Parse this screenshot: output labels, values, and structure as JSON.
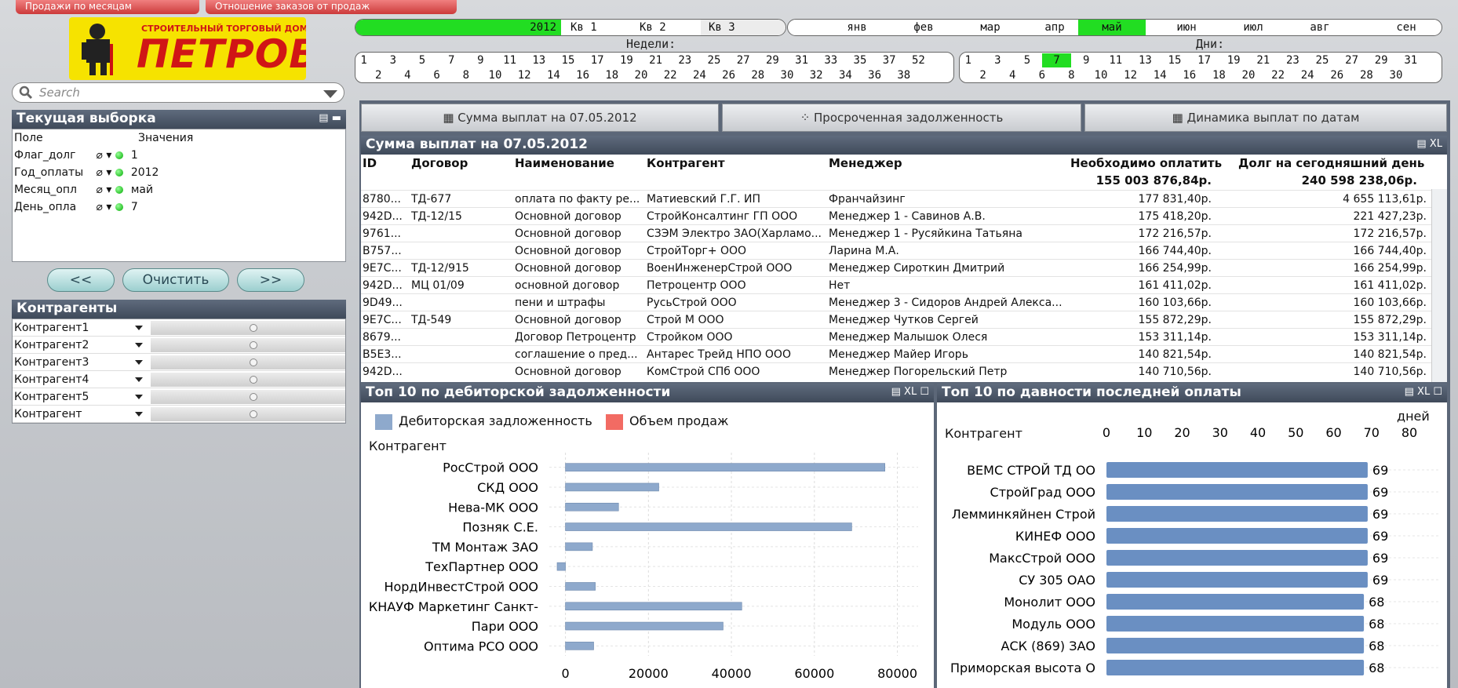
{
  "top_tabs": [
    "Продажи по месяцам",
    "Отношение заказов от продаж"
  ],
  "logo": {
    "small": "СТРОИТЕЛЬНЫЙ ТОРГОВЫЙ ДОМ",
    "big": "ПЕТРОВИЧ"
  },
  "search": {
    "placeholder": "Search"
  },
  "current_selection": {
    "title": "Текущая выборка",
    "col_field": "Поле",
    "col_values": "Значения",
    "rows": [
      {
        "field": "Флаг_долг",
        "value": "1"
      },
      {
        "field": "Год_оплаты",
        "value": "2012"
      },
      {
        "field": "Месяц_опл",
        "value": "май"
      },
      {
        "field": "День_опла",
        "value": "7"
      }
    ]
  },
  "nav": {
    "prev": "<<",
    "clear": "Очистить",
    "next": ">>"
  },
  "contractors": {
    "title": "Контрагенты",
    "items": [
      "Контрагент1",
      "Контрагент2",
      "Контрагент3",
      "Контрагент4",
      "Контрагент5",
      "Контрагент"
    ]
  },
  "period": {
    "year": "2012",
    "quarters": [
      "Кв 1",
      "Кв 2",
      "Кв 3"
    ],
    "months": [
      "янв",
      "фев",
      "мар",
      "апр",
      "май",
      "июн",
      "июл",
      "авг",
      "сен"
    ],
    "selected_month": "май",
    "weeks_label": "Недели:",
    "days_label": "Дни:",
    "weeks_top": [
      "1",
      "3",
      "5",
      "7",
      "9",
      "11",
      "13",
      "15",
      "17",
      "19",
      "21",
      "23",
      "25",
      "27",
      "29",
      "31",
      "33",
      "35",
      "37",
      "52"
    ],
    "weeks_bottom": [
      "2",
      "4",
      "6",
      "8",
      "10",
      "12",
      "14",
      "16",
      "18",
      "20",
      "22",
      "24",
      "26",
      "28",
      "30",
      "32",
      "34",
      "36",
      "38"
    ],
    "days_top": [
      "1",
      "3",
      "5",
      "7",
      "9",
      "11",
      "13",
      "15",
      "17",
      "19",
      "21",
      "23",
      "25",
      "27",
      "29",
      "31"
    ],
    "days_bottom": [
      "2",
      "4",
      "6",
      "8",
      "10",
      "12",
      "14",
      "16",
      "18",
      "20",
      "22",
      "24",
      "26",
      "28",
      "30"
    ],
    "selected_day": "7",
    "highlight_green": "#22dd22"
  },
  "view_tabs": [
    "Сумма выплат на 07.05.2012",
    "Просроченная задолженность",
    "Динамика выплат по датам"
  ],
  "payments_table": {
    "title": "Сумма выплат на 07.05.2012",
    "header_ctrls": "XL",
    "columns": [
      "ID",
      "Договор",
      "Наименование",
      "Контрагент",
      "Менеджер",
      "Необходимо оплатить",
      "Долг на сегодняшний день"
    ],
    "totals": {
      "need_pay": "155 003 876,84р.",
      "debt_today": "240 598 238,06р."
    },
    "rows": [
      {
        "id": "8780...",
        "contract": "ТД-677",
        "name": "оплата по факту ре...",
        "contractor": "Матиевский Г.Г. ИП",
        "manager": "Франчайзинг",
        "need": "177 831,40р.",
        "debt": "4 655 113,61р."
      },
      {
        "id": "942D...",
        "contract": "ТД-12/15",
        "name": "Основной договор",
        "contractor": "СтройКонсалтинг ГП ООО",
        "manager": "Менеджер 1 - Савинов А.В.",
        "need": "175 418,20р.",
        "debt": "221 427,23р."
      },
      {
        "id": "9761...",
        "contract": "",
        "name": "Основной договор",
        "contractor": "СЗЭМ Электро ЗАО(Харламо...",
        "manager": "Менеджер 1 - Русяйкина Татьяна",
        "need": "172 216,57р.",
        "debt": "172 216,57р."
      },
      {
        "id": "B757...",
        "contract": "",
        "name": "Основной договор",
        "contractor": "СтройТорг+ ООО",
        "manager": "Ларина М.А.",
        "need": "166 744,40р.",
        "debt": "166 744,40р."
      },
      {
        "id": "9E7C...",
        "contract": "ТД-12/915",
        "name": "Основной договор",
        "contractor": "ВоенИнженерСтрой ООО",
        "manager": "Менеджер Сироткин Дмитрий",
        "need": "166 254,99р.",
        "debt": "166 254,99р."
      },
      {
        "id": "942D...",
        "contract": "МЦ 01/09",
        "name": "основной договор",
        "contractor": "Петроцентр ООО",
        "manager": "Нет",
        "need": "161 411,02р.",
        "debt": "161 411,02р."
      },
      {
        "id": "9D49...",
        "contract": "",
        "name": "пени и штрафы",
        "contractor": "РусьСтрой ООО",
        "manager": "Менеджер 3 - Сидоров Андрей Алекса...",
        "need": "160 103,66р.",
        "debt": "160 103,66р."
      },
      {
        "id": "9E7C...",
        "contract": "ТД-549",
        "name": "Основной договор",
        "contractor": "Строй М ООО",
        "manager": "Менеджер Чутков Сергей",
        "need": "155 872,29р.",
        "debt": "155 872,29р."
      },
      {
        "id": "8679...",
        "contract": "",
        "name": "Договор Петроцентр",
        "contractor": "Стройком ООО",
        "manager": "Менеджер Малышок Олеся",
        "need": "153 311,14р.",
        "debt": "153 311,14р."
      },
      {
        "id": "B5E3...",
        "contract": "",
        "name": "соглашение о пред...",
        "contractor": "Антарес Трейд НПО ООО",
        "manager": "Менеджер Майер Игорь",
        "need": "140 821,54р.",
        "debt": "140 821,54р."
      },
      {
        "id": "942D...",
        "contract": "",
        "name": "Основной договор",
        "contractor": "КомСтрой СПб ООО",
        "manager": "Менеджер Погорельский Петр",
        "need": "140 710,56р.",
        "debt": "140 710,56р."
      }
    ]
  },
  "chart_data": [
    {
      "type": "bar",
      "title": "Топ 10 по дебиторской задолженности",
      "header_ctrls": "XL",
      "orientation": "horizontal",
      "ylabel": "Контрагент",
      "categories": [
        "РосСтрой ООО",
        "СКД ООО",
        "Нева-МК ООО",
        "Позняк С.Е.",
        "ТМ Монтаж ЗАО",
        "ТехПартнер ООО",
        "НордИнвестСтрой ООО",
        "КНАУФ Маркетинг Санкт-",
        "Пари ООО",
        "Оптима РСО ООО"
      ],
      "series": [
        {
          "name": "Дебиторская задложенность",
          "color": "#8ea9cc",
          "values": [
            77000,
            22500,
            12800,
            69000,
            6500,
            -2000,
            7200,
            42500,
            38000,
            6800
          ]
        },
        {
          "name": "Объем продаж",
          "color": "#f26b63",
          "values": []
        }
      ],
      "xlim": [
        -2000,
        85000
      ],
      "xticks": [
        "0",
        "20000",
        "40000",
        "60000",
        "80000"
      ],
      "grid": true,
      "legend": "top-left"
    },
    {
      "type": "bar",
      "title": "Топ 10 по давности последней оплаты",
      "header_ctrls": "XL",
      "orientation": "horizontal",
      "ylabel": "Контрагент",
      "xlabel": "дней",
      "categories": [
        "ВЕМС СТРОЙ ТД ОО",
        "СтройГрад ООО",
        "Лемминкяйнен Строй",
        "КИНЕФ ООО",
        "МаксСтрой ООО",
        "СУ 305 ОАО",
        "Монолит ООО",
        "Модуль ООО",
        "АСК (869) ЗАО",
        "Приморская высота О"
      ],
      "series": [
        {
          "name": "",
          "color": "#6a8fc2",
          "values": [
            69,
            69,
            69,
            69,
            69,
            69,
            68,
            68,
            68,
            68
          ]
        }
      ],
      "xlim": [
        0,
        80
      ],
      "xticks": [
        "0",
        "10",
        "20",
        "30",
        "40",
        "50",
        "60",
        "70",
        "80"
      ],
      "data_labels": [
        "69",
        "69",
        "69",
        "69",
        "69",
        "69",
        "68",
        "68",
        "68",
        "68"
      ],
      "grid": true
    }
  ]
}
